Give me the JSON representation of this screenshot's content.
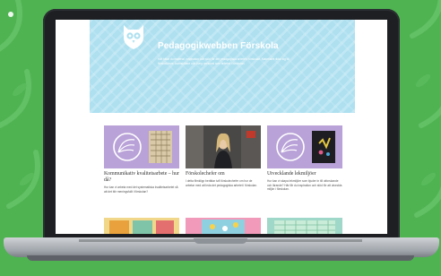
{
  "hero": {
    "title": "Pedagogikwebben Förskola",
    "text": "Här hittar du material, inspiration och stöd för det pedagogiska arbetet i förskolan. Materialet riktar sig till förskollärare, barnskötare och övrig personal som arbetar i förskolan."
  },
  "cards": [
    {
      "title": "Kommunikativ kvalitetsarbete – hur då?",
      "text": "Hur kan vi arbeta med det systematiska kvalitetsarbetet så att det blir meningsfullt i förskolan?"
    },
    {
      "title": "Förskolechefer om",
      "text": "I detta filmklipp berättar två förskolechefer om hur de arbetar med att leda det pedagogiska arbetet i förskolan."
    },
    {
      "title": "Utvecklande lekmiljöer",
      "text": "Hur kan vi skapa lekmiljöer som bjuder in till utforskande och lärande? Här får du inspiration och stöd för att utveckla miljön i förskolan."
    }
  ],
  "colors": {
    "background": "#4fb352",
    "hero": "#aee0f0",
    "card_purple": "#b9a2d8"
  }
}
